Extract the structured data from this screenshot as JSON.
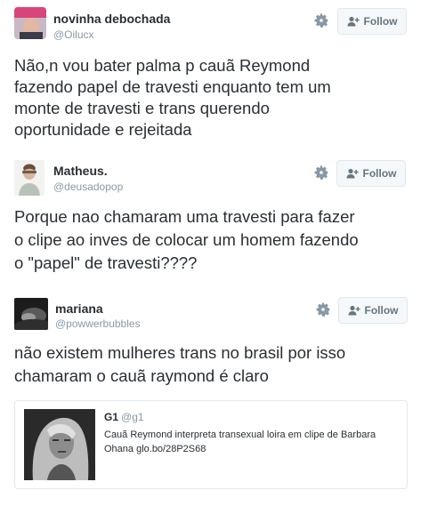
{
  "tweets": [
    {
      "user_name": "novinha debochada",
      "handle": "@Oilucx",
      "follow_label": "Follow",
      "lines": [
        "Não,n vou bater palma p cauã Reymond",
        "fazendo papel de travesti enquanto tem um",
        "monte de travesti e trans querendo",
        "oportunidade e rejeitada"
      ]
    },
    {
      "user_name": "Matheus.",
      "handle": "@deusadopop",
      "follow_label": "Follow",
      "lines": [
        "Porque nao chamaram uma travesti para fazer",
        "o clipe ao inves de colocar um homem fazendo",
        "o \"papel\" de travesti????"
      ]
    },
    {
      "user_name": "mariana",
      "handle": "@powwerbubbles",
      "follow_label": "Follow",
      "lines": [
        "não existem mulheres trans no brasil por isso",
        "chamaram o cauã raymond é claro"
      ]
    }
  ],
  "quoted": {
    "user_name": "G1",
    "handle": "@g1",
    "text": "Cauã Reymond interpreta transexual loira em clipe de Barbara Ohana glo.bo/28P2S68"
  },
  "icons": {
    "gear": "gear-icon",
    "follow": "follow-person-plus-icon"
  },
  "colors": {
    "text": "#292f33",
    "muted": "#8899a6",
    "button_bg": "#f5f8fa",
    "border": "#e1e8ed"
  }
}
